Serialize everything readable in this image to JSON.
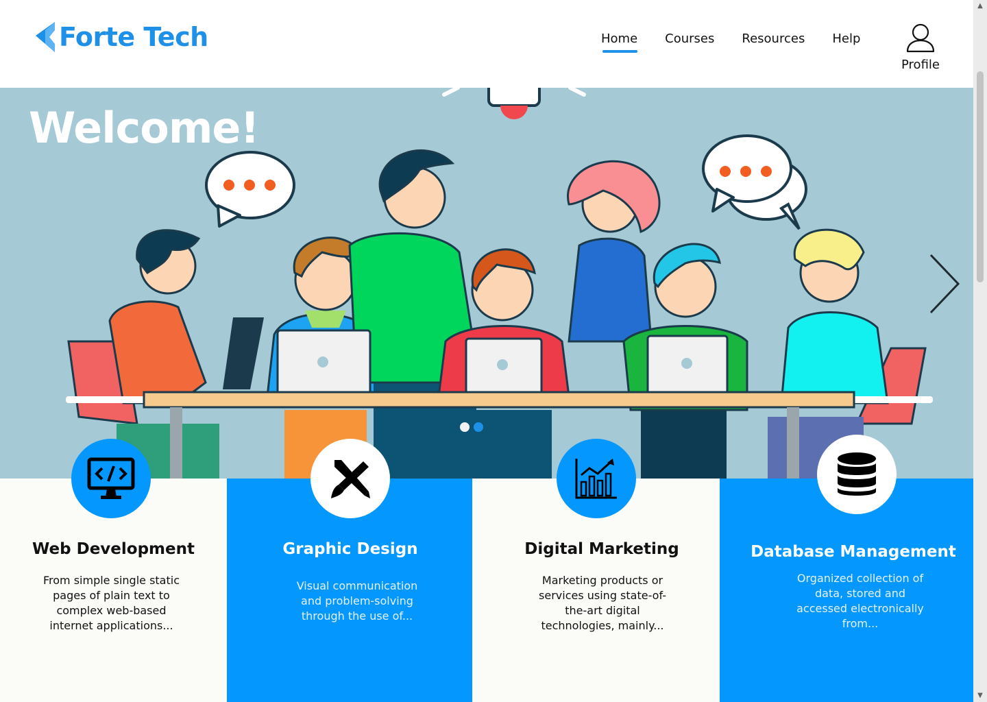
{
  "brand": {
    "name": "Forte Tech",
    "color": "#1e90e8"
  },
  "nav": {
    "items": [
      {
        "label": "Home",
        "active": true
      },
      {
        "label": "Courses",
        "active": false
      },
      {
        "label": "Resources",
        "active": false
      },
      {
        "label": "Help",
        "active": false
      }
    ],
    "profile_label": "Profile"
  },
  "hero": {
    "heading": "Welcome!",
    "background_color": "#a6c9d6",
    "slides_total": 2,
    "active_slide": 1,
    "next_icon": "chevron-right-icon"
  },
  "cards": [
    {
      "title": "Web Development",
      "description": "From simple single static pages of plain text to complex web-based internet applications...",
      "icon": "code-monitor-icon",
      "theme": "light"
    },
    {
      "title": "Graphic Design",
      "description": "Visual communication and problem-solving through the use of...",
      "icon": "pencil-brush-icon",
      "theme": "blue"
    },
    {
      "title": "Digital Marketing",
      "description": "Marketing products or services using state-of-the-art digital technologies, mainly...",
      "icon": "bar-chart-icon",
      "theme": "light"
    },
    {
      "title": "Database Management",
      "description": "Organized collection of data, stored and accessed electronically from...",
      "icon": "database-icon",
      "theme": "blue"
    }
  ],
  "colors": {
    "accent": "#0497fd",
    "card_light": "#fbfcf8"
  }
}
